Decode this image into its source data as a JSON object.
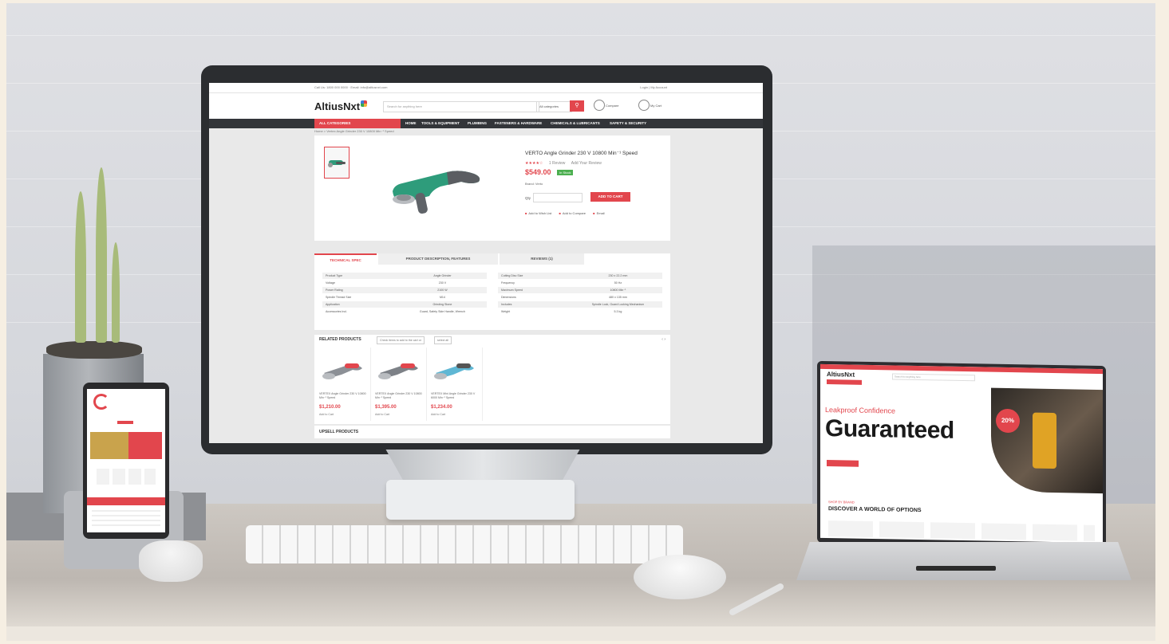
{
  "monitor_site": {
    "topbar": {
      "left": "Call Us: 1800 000 0000 · Email: info@altiusnxt.com",
      "right": "Login | My Account"
    },
    "logo": "AltiusNxt",
    "search_placeholder": "Search for anything here",
    "search_category": "All categories",
    "search_icon": "search-icon",
    "compare_label": "Compare",
    "cart_label": "My Cart",
    "all_categories": "ALL CATEGORIES",
    "nav": [
      "HOME",
      "TOOLS & EQUIPMENT",
      "PLUMBING",
      "FASTENERS & HARDWARE",
      "CHEMICALS & LUBRICANTS",
      "SAFETY & SECURITY"
    ],
    "breadcrumb": "Home > Vertex Angle Grinder 230 V 10800 Min⁻¹ Speed",
    "product": {
      "title": "VERTO Angle Grinder 230 V 10800 Min⁻¹ Speed",
      "stars": "★★★★☆",
      "reviews": "1 Review",
      "add_review": "Add Your Review",
      "price": "$549.00",
      "stock": "In Stock",
      "brand": "Brand: Verto",
      "qty_label": "Qty",
      "add_to_cart": "ADD TO CART",
      "actions": [
        "Add to Wish List",
        "Add to Compare",
        "Email"
      ]
    },
    "tabs": [
      "TECHNICAL SPEC",
      "PRODUCT DESCRIPTION, FEATURES",
      "REVIEWS (1)"
    ],
    "specs_left": [
      {
        "k": "Product Type",
        "v": "Angle Grinder"
      },
      {
        "k": "Voltage",
        "v": "230 V"
      },
      {
        "k": "Power Rating",
        "v": "2100 W"
      },
      {
        "k": "Spindle Thread Size",
        "v": "M14"
      },
      {
        "k": "Application",
        "v": "Grinding Stone"
      },
      {
        "k": "Accessories Incl.",
        "v": "Guard, Safety Side Handle, Wrench"
      }
    ],
    "specs_right": [
      {
        "k": "Cutting Disc Size",
        "v": "230 x 22.2 mm"
      },
      {
        "k": "Frequency",
        "v": "50 Hz"
      },
      {
        "k": "Maximum Speed",
        "v": "10800 Min⁻¹"
      },
      {
        "k": "Dimensions",
        "v": "480 x 135 mm"
      },
      {
        "k": "Includes",
        "v": "Spindle Lock, Guard Locking Mechanism"
      },
      {
        "k": "Weight",
        "v": "5.3 kg"
      }
    ],
    "related": {
      "title": "RELATED PRODUCTS",
      "chips": [
        "Check items to add to the cart or",
        "select all"
      ],
      "arrows": "‹  ›",
      "items": [
        {
          "name": "VERTEX Angle Grinder 230 V 10800 Min⁻¹ Speed",
          "price": "$1,210.00",
          "wish": "Add to Cart"
        },
        {
          "name": "VERTEX Angle Grinder 230 V 10800 Min⁻¹ Speed",
          "price": "$1,395.00",
          "wish": "Add to Cart"
        },
        {
          "name": "VERTEX Mini Angle Grinder 230 V 6000 Min⁻¹ Speed",
          "price": "$1,234.00",
          "wish": "Add to Cart"
        }
      ]
    },
    "upsell_title": "UPSELL PRODUCTS"
  },
  "laptop_site": {
    "logo": "AltiusNxt",
    "search_placeholder": "Search for anything here",
    "kicker": "Leakproof Confidence",
    "hero": "Guaranteed",
    "badge": "20%",
    "section_tag": "SHOP BY BRAND",
    "section_title": "DISCOVER A WORLD OF OPTIONS"
  },
  "colors": {
    "accent": "#e2464d",
    "nav_bg": "#333539",
    "stock": "#4caf50"
  }
}
